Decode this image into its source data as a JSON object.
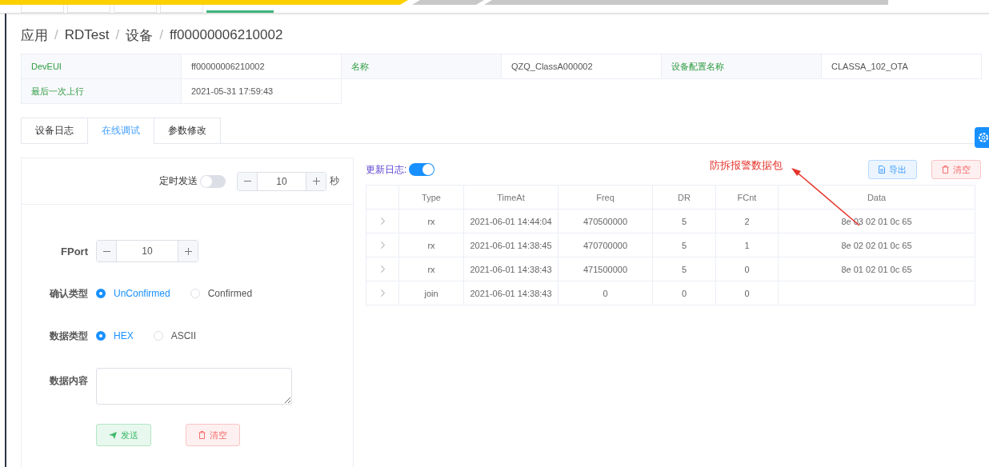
{
  "top_tabs": [
    {
      "selected": false
    },
    {
      "selected": false
    },
    {
      "selected": false
    },
    {
      "selected": false
    },
    {
      "selected": true
    }
  ],
  "breadcrumb": {
    "separator": "/",
    "items": [
      "应用",
      "RDTest",
      "设备",
      "ff00000006210002"
    ]
  },
  "details": [
    [
      {
        "label": "DevEUI",
        "value": "ff00000006210002"
      },
      {
        "label": "名称",
        "value": "QZQ_ClassA000002"
      },
      {
        "label": "设备配置名称",
        "value": "CLASSA_102_OTA"
      }
    ],
    [
      {
        "label": "最后一次上行",
        "value": "2021-05-31 17:59:43"
      }
    ]
  ],
  "tabs": [
    {
      "label": "设备日志",
      "selected": false
    },
    {
      "label": "在线调试",
      "selected": true
    },
    {
      "label": "参数修改",
      "selected": false
    }
  ],
  "timer": {
    "label": "定时发送",
    "on": false,
    "value": "10",
    "unit": "秒"
  },
  "form": {
    "fport_label": "FPort",
    "fport_value": "10",
    "confirm_label": "确认类型",
    "confirm_options": [
      {
        "label": "UnConfirmed",
        "selected": true
      },
      {
        "label": "Confirmed",
        "selected": false
      }
    ],
    "data_type_label": "数据类型",
    "data_type_options": [
      {
        "label": "HEX",
        "selected": true
      },
      {
        "label": "ASCII",
        "selected": false
      }
    ],
    "content_label": "数据内容",
    "send": "发送",
    "clear": "清空"
  },
  "log": {
    "label": "更新日志:",
    "on": true,
    "export": "导出",
    "clear": "清空",
    "columns": [
      "Type",
      "TimeAt",
      "Freq",
      "DR",
      "FCnt",
      "Data"
    ],
    "rows": [
      [
        "rx",
        "2021-06-01 14:44:04",
        "470500000",
        "5",
        "2",
        "8e 03 02 01 0c 65"
      ],
      [
        "rx",
        "2021-06-01 14:38:45",
        "470700000",
        "5",
        "1",
        "8e 02 02 01 0c 65"
      ],
      [
        "rx",
        "2021-06-01 14:38:43",
        "471500000",
        "5",
        "0",
        "8e 01 02 01 0c 65"
      ],
      [
        "join",
        "2021-06-01 14:38:43",
        "0",
        "0",
        "0",
        ""
      ]
    ]
  },
  "annotation": "防拆报警数据包"
}
